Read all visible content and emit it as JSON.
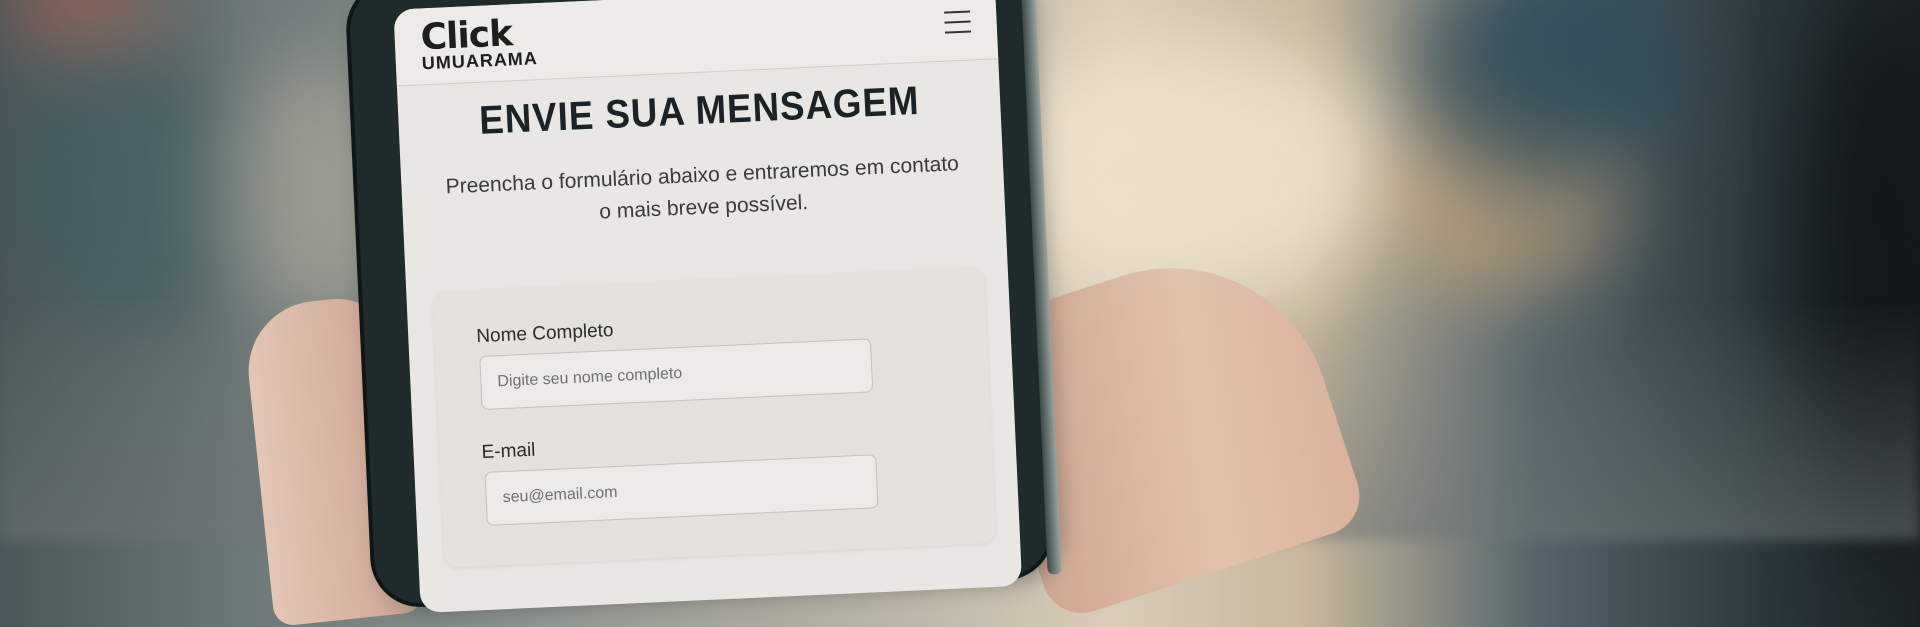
{
  "app": {
    "logo_main": "Click",
    "logo_sub": "UMUARAMA",
    "menu_icon": "hamburger-menu-icon"
  },
  "page": {
    "title": "ENVIE SUA MENSAGEM",
    "subtitle": "Preencha o formulário abaixo e entraremos em contato o mais breve possível."
  },
  "form": {
    "name_label": "Nome Completo",
    "name_placeholder": "Digite seu nome completo",
    "email_label": "E-mail",
    "email_placeholder": "seu@email.com"
  }
}
